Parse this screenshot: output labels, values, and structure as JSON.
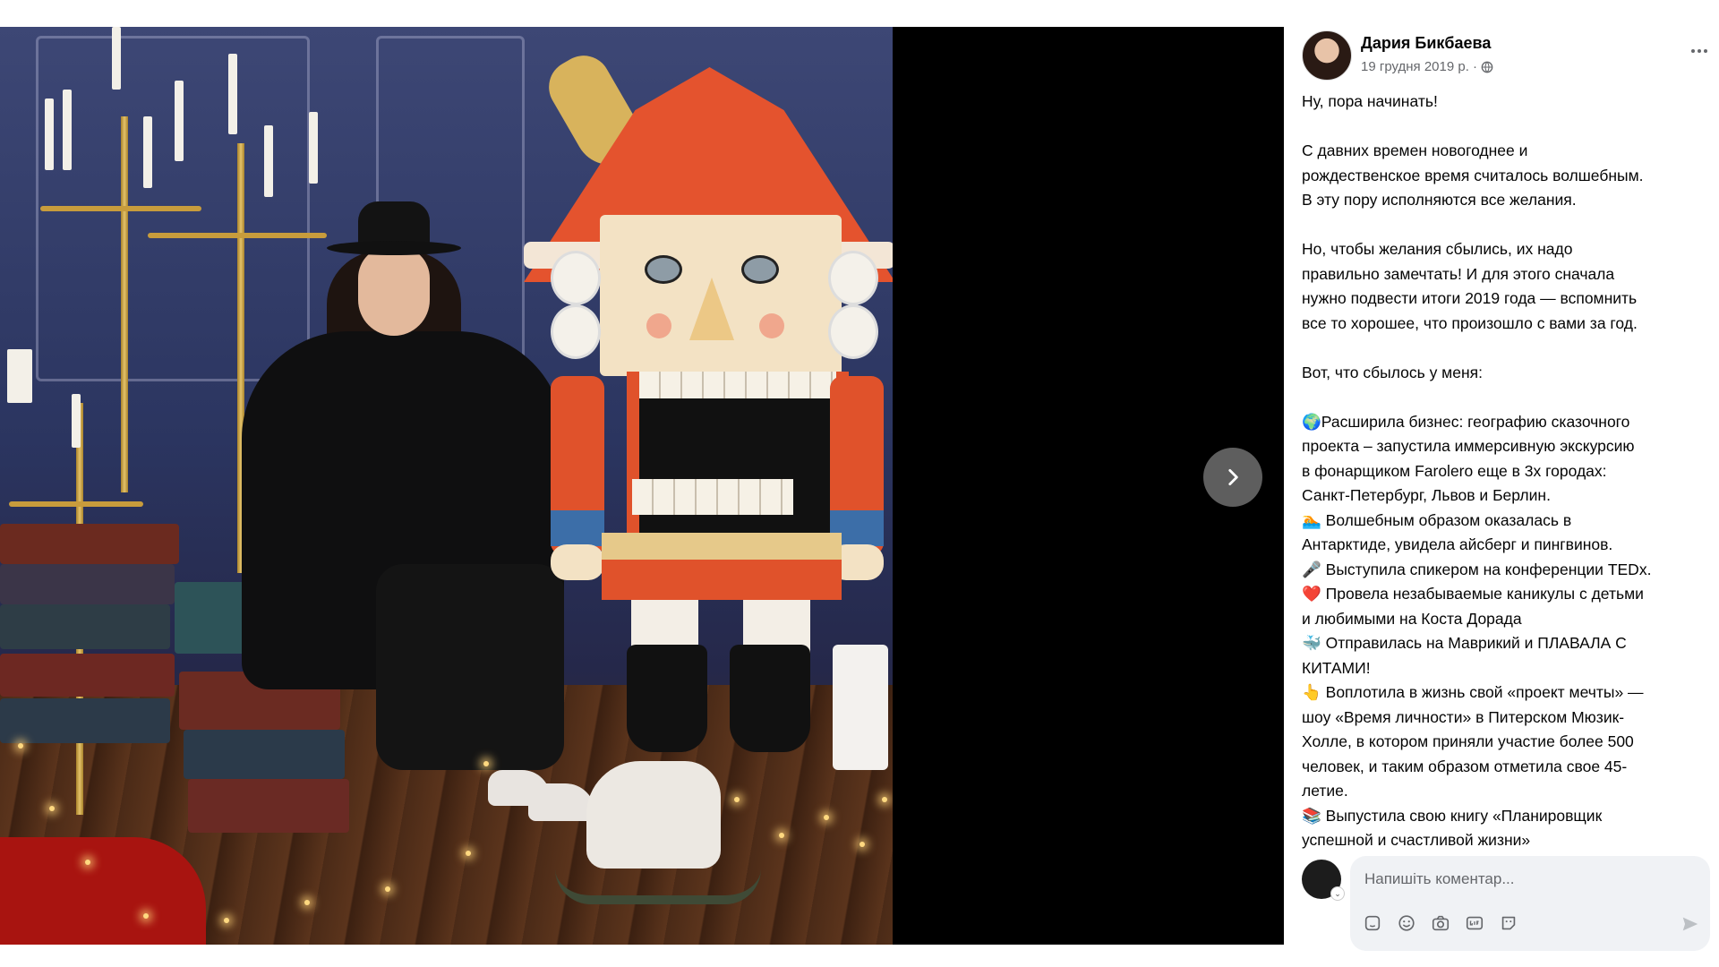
{
  "post": {
    "author": "Дария Бикбаева",
    "date": "19 грудня 2019 р. ·",
    "text": "Ну, пора начинать!\n\nС давних времен новогоднее и\nрождественское время считалось волшебным.\nВ эту пору исполняются все желания.\n\nНо, чтобы желания сбылись, их надо\nправильно замечтать! И для этого сначала\nнужно подвести итоги 2019 года — вспомнить\nвсе то хорошее, что произошло с вами за год.\n\nВот, что сбылось у меня:\n\n🌍Расширила бизнес: географию сказочного\nпроекта – запустила иммерсивную экскурсию\nв фонарщиком Farolero еще в 3х городах:\nСанкт-Петербург, Львов и Берлин.\n🏊 Волшебным образом оказалась в\nАнтарктиде, увидела айсберг и пингвинов.\n🎤 Выступила спикером на конференции TEDx.\n❤️ Провела незабываемые каникулы с детьми\nи любимыми на Коста Дорада\n🐳 Отправилась на Маврикий и ПЛАВАЛА С\nКИТАМИ!\n👆 Воплотила в жизнь свой «проект мечты» —\nшоу «Время личности» в Питерском Мюзик-\nХолле, в котором приняли участие более 500\nчеловек, и таким образом отметила свое 45-\nлетие.\n📚 Выпустила свою книгу «Планировщик\nуспешной и счастливой жизни»"
  },
  "comment": {
    "placeholder": "Напишіть коментар..."
  },
  "icons": {
    "next": "chevron-right-icon",
    "privacy": "globe-icon",
    "more": "more-options-icon",
    "tools": [
      "sticker-icon",
      "emoji-icon",
      "camera-icon",
      "gif-icon",
      "avatar-sticker-icon"
    ],
    "send": "send-icon"
  },
  "colors": {
    "text": "#050505",
    "secondary": "#65676b",
    "comment_bg": "#f0f2f5",
    "viewer_bg": "#000000"
  }
}
